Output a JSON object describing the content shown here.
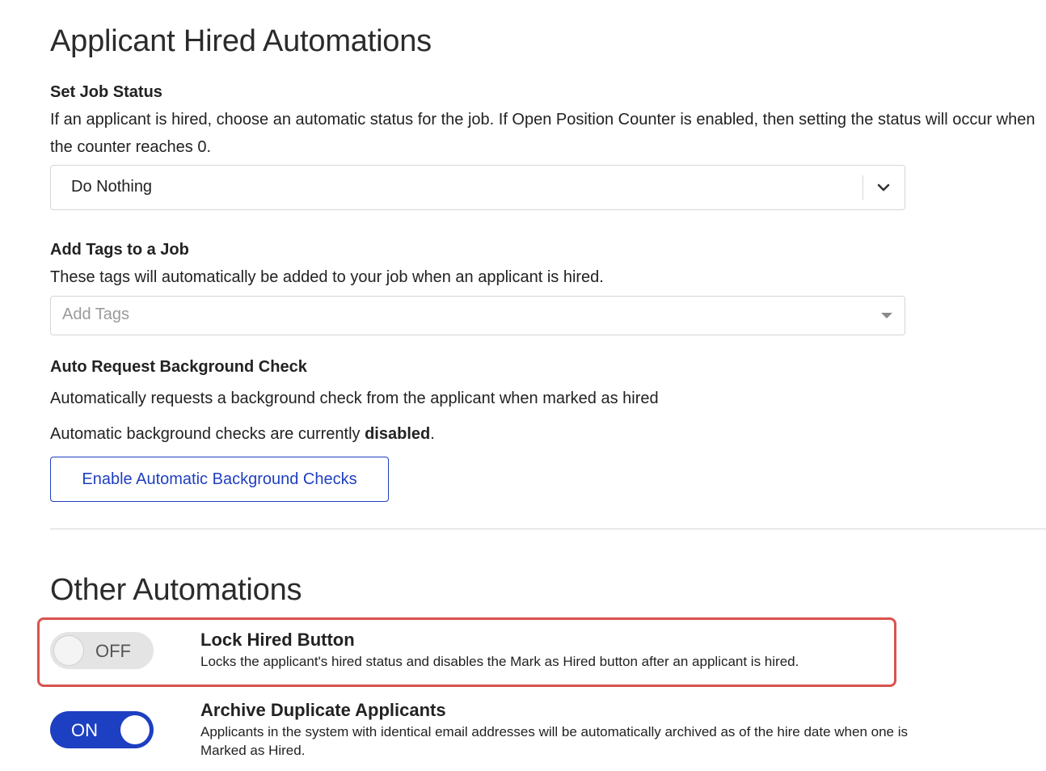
{
  "section_hired": {
    "title": "Applicant Hired Automations",
    "job_status": {
      "label": "Set Job Status",
      "description": "If an applicant is hired, choose an automatic status for the job. If Open Position Counter is enabled, then setting the status will occur when the counter reaches 0.",
      "selected_value": "Do Nothing",
      "icon": "chevron-down-icon"
    },
    "tags": {
      "label": "Add Tags to a Job",
      "description": "These tags will automatically be added to your job when an applicant is hired.",
      "placeholder": "Add Tags",
      "icon": "caret-down-icon"
    },
    "background_check": {
      "label": "Auto Request Background Check",
      "description": "Automatically requests a background check from the applicant when marked as hired",
      "status_prefix": "Automatic background checks are currently ",
      "status_value": "disabled",
      "status_suffix": ".",
      "button_label": "Enable Automatic Background Checks"
    }
  },
  "section_other": {
    "title": "Other Automations",
    "items": [
      {
        "toggle_state": "OFF",
        "title": "Lock Hired Button",
        "description": "Locks the applicant's hired status and disables the Mark as Hired button after an applicant is hired.",
        "highlighted": true
      },
      {
        "toggle_state": "ON",
        "title": "Archive Duplicate Applicants",
        "description": "Applicants in the system with identical email addresses will be automatically archived as of the hire date when one is Marked as Hired.",
        "highlighted": false
      }
    ]
  },
  "colors": {
    "accent": "#1d3fc1",
    "highlight_border": "#d9534f",
    "toggle_off_bg": "#e4e4e4"
  }
}
